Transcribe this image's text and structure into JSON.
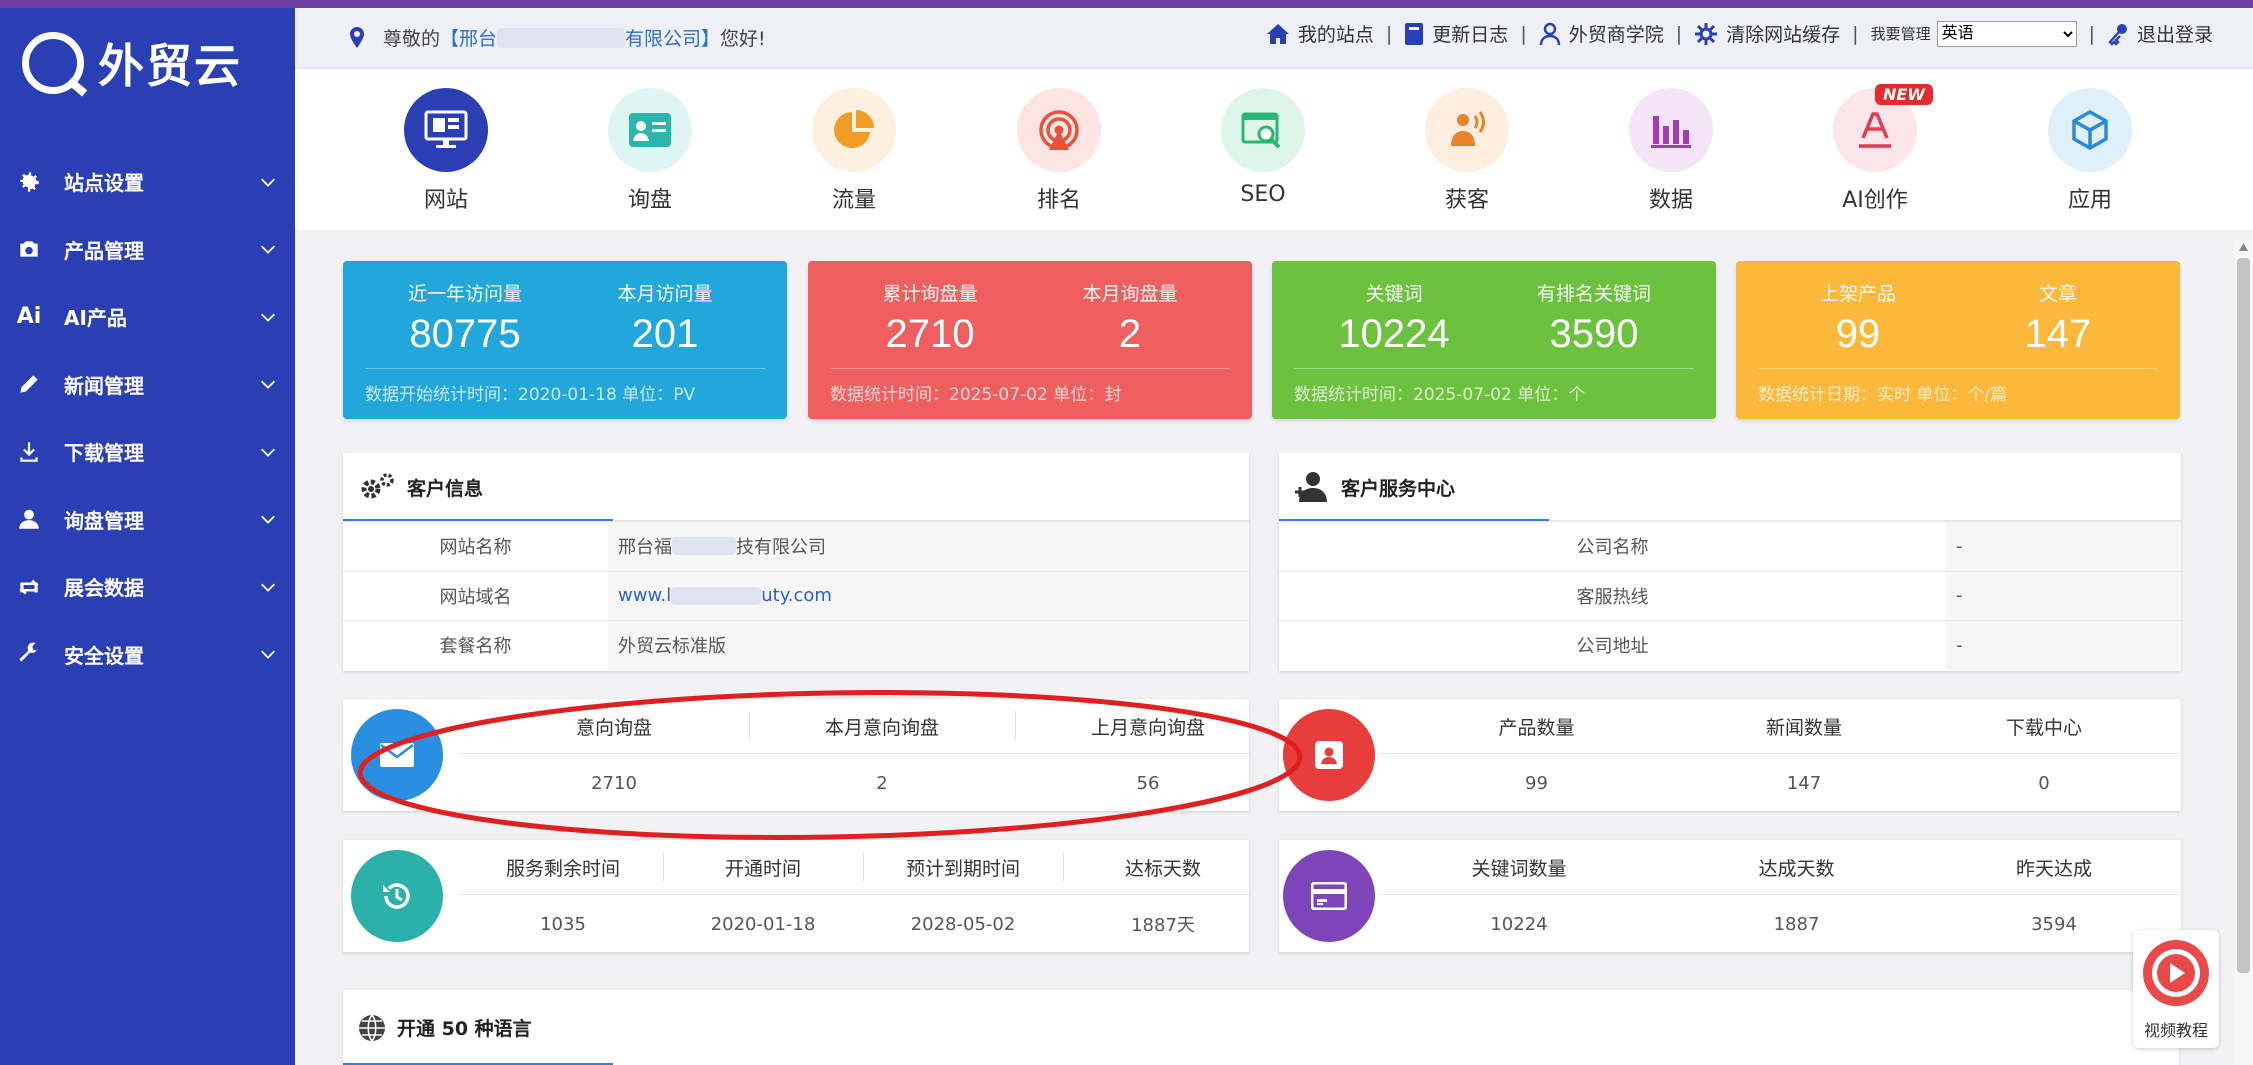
{
  "brand": {
    "name": "外贸云"
  },
  "sidebar": {
    "items": [
      {
        "label": "站点设置",
        "icon": "gear-icon"
      },
      {
        "label": "产品管理",
        "icon": "camera-icon"
      },
      {
        "label": "AI产品",
        "icon": "ai-icon",
        "icon_text": "Ai"
      },
      {
        "label": "新闻管理",
        "icon": "pencil-icon"
      },
      {
        "label": "下载管理",
        "icon": "download-icon"
      },
      {
        "label": "询盘管理",
        "icon": "user-icon"
      },
      {
        "label": "展会数据",
        "icon": "exchange-icon"
      },
      {
        "label": "安全设置",
        "icon": "wrench-icon"
      }
    ]
  },
  "header": {
    "greeting_prefix": "尊敬的",
    "company_open": "【邢台",
    "company_close": "有限公司】",
    "greeting_suffix": "您好!",
    "nav": {
      "my_site": "我的站点",
      "changelog": "更新日志",
      "academy": "外贸商学院",
      "clear_cache": "清除网站缓存",
      "manage": "我要管理",
      "language": "英语",
      "logout": "退出登录"
    }
  },
  "quick": [
    {
      "label": "网站",
      "icon": "monitor-icon",
      "bg": "#2a3fb4",
      "fg": "#ffffff"
    },
    {
      "label": "询盘",
      "icon": "inquiry-card-icon",
      "bg": "#dff5f3",
      "fg": "#2bb6ad"
    },
    {
      "label": "流量",
      "icon": "pie-chart-icon",
      "bg": "#fdf0e0",
      "fg": "#f29c25"
    },
    {
      "label": "排名",
      "icon": "signal-icon",
      "bg": "#fde5e3",
      "fg": "#e5533b"
    },
    {
      "label": "SEO",
      "icon": "seo-search-icon",
      "bg": "#def6ea",
      "fg": "#2bb673"
    },
    {
      "label": "获客",
      "icon": "speaker-icon",
      "bg": "#fdeee0",
      "fg": "#e7832a"
    },
    {
      "label": "数据",
      "icon": "bar-chart-icon",
      "bg": "#f3e4f6",
      "fg": "#a43bb4"
    },
    {
      "label": "AI创作",
      "icon": "ai-write-icon",
      "bg": "#fde6ea",
      "fg": "#e23b55",
      "badge": "NEW"
    },
    {
      "label": "应用",
      "icon": "cube-icon",
      "bg": "#e0f0fb",
      "fg": "#2a8ad6"
    }
  ],
  "stats": [
    {
      "color": "#22a7db",
      "a_label": "近一年访问量",
      "a_value": "80775",
      "b_label": "本月访问量",
      "b_value": "201",
      "footer": "数据开始统计时间：2020-01-18    单位：PV"
    },
    {
      "color": "#ef5f5f",
      "a_label": "累计询盘量",
      "a_value": "2710",
      "b_label": "本月询盘量",
      "b_value": "2",
      "footer": "数据统计时间：2025-07-02    单位：封"
    },
    {
      "color": "#6cc13e",
      "a_label": "关键词",
      "a_value": "10224",
      "b_label": "有排名关键词",
      "b_value": "3590",
      "footer": "数据统计时间：2025-07-02    单位：个"
    },
    {
      "color": "#fbb83a",
      "a_label": "上架产品",
      "a_value": "99",
      "b_label": "文章",
      "b_value": "147",
      "footer": "数据统计日期：实时    单位：个/篇"
    }
  ],
  "customer_info": {
    "title": "客户信息",
    "rows": [
      {
        "key": "网站名称",
        "value_pre": "邢台福",
        "value_post": "技有限公司"
      },
      {
        "key": "网站域名",
        "value_pre": "www.l",
        "value_post": "uty.com"
      },
      {
        "key": "套餐名称",
        "value_pre": "外贸云标准版",
        "value_post": ""
      }
    ]
  },
  "service_center": {
    "title": "客户服务中心",
    "rows": [
      {
        "key": "公司名称",
        "value": "-"
      },
      {
        "key": "客服热线",
        "value": "-"
      },
      {
        "key": "公司地址",
        "value": "-"
      }
    ]
  },
  "inquiry_box": {
    "headers": [
      "意向询盘",
      "本月意向询盘",
      "上月意向询盘"
    ],
    "values": [
      "2710",
      "2",
      "56"
    ]
  },
  "content_box": {
    "headers": [
      "产品数量",
      "新闻数量",
      "下载中心"
    ],
    "values": [
      "99",
      "147",
      "0"
    ]
  },
  "service_box": {
    "headers": [
      "服务剩余时间",
      "开通时间",
      "预计到期时间",
      "达标天数"
    ],
    "values": [
      "1035",
      "2020-01-18",
      "2028-05-02",
      "1887天"
    ]
  },
  "keyword_box": {
    "headers": [
      "关键词数量",
      "达成天数",
      "昨天达成"
    ],
    "values": [
      "10224",
      "1887",
      "3594"
    ]
  },
  "languages": {
    "title": "开通 50 种语言"
  },
  "video": {
    "label": "视频教程"
  }
}
